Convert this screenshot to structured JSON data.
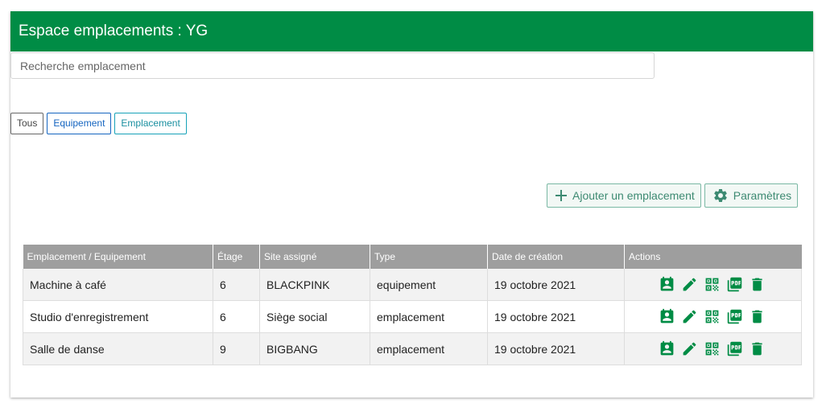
{
  "header": {
    "title": "Espace emplacements : YG"
  },
  "search": {
    "placeholder": "Recherche emplacement"
  },
  "filters": {
    "all": "Tous",
    "equipement": "Equipement",
    "emplacement": "Emplacement"
  },
  "toolbar": {
    "add_label": "Ajouter un emplacement",
    "settings_label": "Paramètres"
  },
  "table": {
    "headers": [
      "Emplacement / Equipement",
      "Étage",
      "Site assigné",
      "Type",
      "Date de création",
      "Actions"
    ],
    "rows": [
      {
        "name": "Machine à café",
        "floor": "6",
        "site": "BLACKPINK",
        "type": "equipement",
        "date": "19 octobre 2021"
      },
      {
        "name": "Studio d'enregistrement",
        "floor": "6",
        "site": "Siège social",
        "type": "emplacement",
        "date": "19 octobre 2021"
      },
      {
        "name": "Salle de danse",
        "floor": "9",
        "site": "BIGBANG",
        "type": "emplacement",
        "date": "19 octobre 2021"
      }
    ],
    "action_icons": [
      "contact-icon",
      "edit-icon",
      "qr-code-icon",
      "pdf-icon",
      "delete-icon"
    ]
  },
  "colors": {
    "brand": "#008c45",
    "header_bg": "#9e9e9e"
  }
}
